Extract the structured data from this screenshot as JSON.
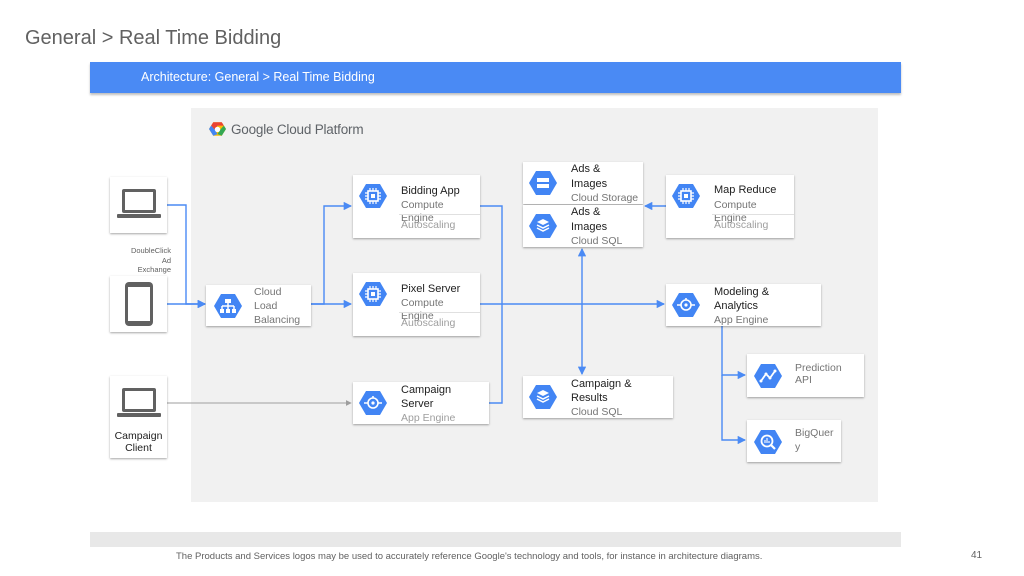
{
  "header": {
    "title": "General > Real Time Bidding",
    "banner": "Architecture: General > Real Time Bidding"
  },
  "platform": {
    "logo_text": "Google Cloud Platform"
  },
  "clients": {
    "doubleclick_label_1": "DoubleClick",
    "doubleclick_label_2": "Ad",
    "doubleclick_label_3": "Exchange",
    "campaign_client_line1": "Campaign",
    "campaign_client_line2": "Client"
  },
  "nodes": {
    "cloud_lb": {
      "line1": "Cloud",
      "line2": "Load",
      "line3": "Balancing"
    },
    "bidding_app": {
      "name": "Bidding App",
      "product1": "Compute",
      "product2": "Engine",
      "feature": "Autoscaling"
    },
    "pixel_server": {
      "name": "Pixel Server",
      "product1": "Compute",
      "product2": "Engine",
      "feature": "Autoscaling"
    },
    "campaign_server": {
      "name1": "Campaign",
      "name2": "Server",
      "product": "App Engine"
    },
    "ads_storage": {
      "name1": "Ads &",
      "name2": "Images",
      "product": "Cloud Storage"
    },
    "ads_sql": {
      "name1": "Ads &",
      "name2": "Images",
      "product": "Cloud SQL"
    },
    "campaign_results": {
      "name1": "Campaign &",
      "name2": "Results",
      "product": "Cloud SQL"
    },
    "map_reduce": {
      "name": "Map Reduce",
      "product1": "Compute",
      "product2": "Engine",
      "feature": "Autoscaling"
    },
    "modeling": {
      "name1": "Modeling &",
      "name2": "Analytics",
      "product": "App Engine"
    },
    "prediction": {
      "line1": "Prediction",
      "line2": "API"
    },
    "bigquery": {
      "line1": "BigQuer",
      "line2": "y"
    }
  },
  "footer": {
    "note": "The Products and Services logos may be used to accurately reference Google's technology and tools, for instance in architecture diagrams.",
    "page_number": "41"
  },
  "colors": {
    "accent": "#4a8af4",
    "icon_blue": "#4285f4",
    "arrow": "#4a8af4",
    "panel": "#f1f1f1"
  }
}
